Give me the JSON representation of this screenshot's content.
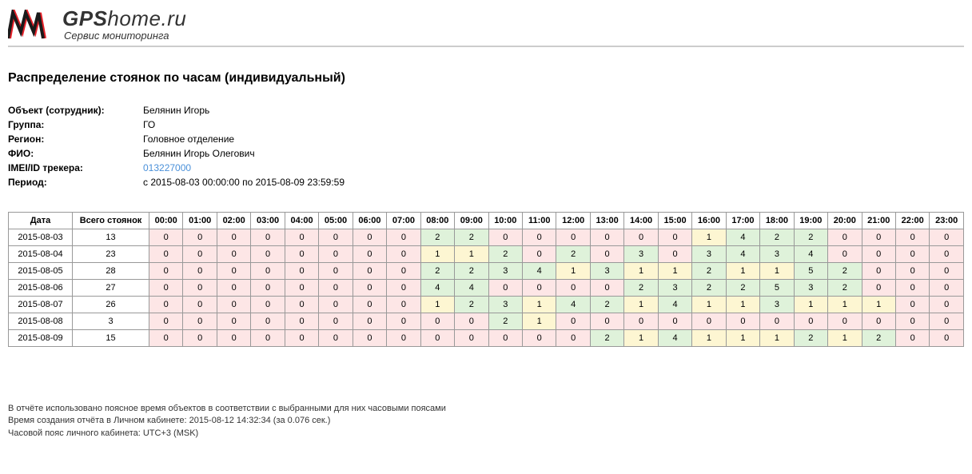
{
  "logo": {
    "gps": "GPS",
    "home": "home",
    "ru": ".ru",
    "tagline": "Сервис мониторинга"
  },
  "title": "Распределение стоянок по часам (индивидуальный)",
  "meta": {
    "object_label": "Объект (сотрудник):",
    "object_value": "Белянин Игорь",
    "group_label": "Группа:",
    "group_value": "ГО",
    "region_label": "Регион:",
    "region_value": "Головное отделение",
    "fio_label": "ФИО:",
    "fio_value": "Белянин Игорь Олегович",
    "imei_label": "IMEI/ID трекера:",
    "imei_value": "013227000",
    "period_label": "Период:",
    "period_value": "с 2015-08-03 00:00:00 по 2015-08-09 23:59:59"
  },
  "table": {
    "date_header": "Дата",
    "total_header": "Всего стоянок",
    "hours": [
      "00:00",
      "01:00",
      "02:00",
      "03:00",
      "04:00",
      "05:00",
      "06:00",
      "07:00",
      "08:00",
      "09:00",
      "10:00",
      "11:00",
      "12:00",
      "13:00",
      "14:00",
      "15:00",
      "16:00",
      "17:00",
      "18:00",
      "19:00",
      "20:00",
      "21:00",
      "22:00",
      "23:00"
    ],
    "rows": [
      {
        "date": "2015-08-03",
        "total": 13,
        "cells": [
          0,
          0,
          0,
          0,
          0,
          0,
          0,
          0,
          2,
          2,
          0,
          0,
          0,
          0,
          0,
          0,
          1,
          4,
          2,
          2,
          0,
          0,
          0,
          0
        ]
      },
      {
        "date": "2015-08-04",
        "total": 23,
        "cells": [
          0,
          0,
          0,
          0,
          0,
          0,
          0,
          0,
          1,
          1,
          2,
          0,
          2,
          0,
          3,
          0,
          3,
          4,
          3,
          4,
          0,
          0,
          0,
          0
        ]
      },
      {
        "date": "2015-08-05",
        "total": 28,
        "cells": [
          0,
          0,
          0,
          0,
          0,
          0,
          0,
          0,
          2,
          2,
          3,
          4,
          1,
          3,
          1,
          1,
          2,
          1,
          1,
          5,
          2,
          0,
          0,
          0
        ]
      },
      {
        "date": "2015-08-06",
        "total": 27,
        "cells": [
          0,
          0,
          0,
          0,
          0,
          0,
          0,
          0,
          4,
          4,
          0,
          0,
          0,
          0,
          2,
          3,
          2,
          2,
          5,
          3,
          2,
          0,
          0,
          0
        ]
      },
      {
        "date": "2015-08-07",
        "total": 26,
        "cells": [
          0,
          0,
          0,
          0,
          0,
          0,
          0,
          0,
          1,
          2,
          3,
          1,
          4,
          2,
          1,
          4,
          1,
          1,
          3,
          1,
          1,
          1,
          0,
          0
        ]
      },
      {
        "date": "2015-08-08",
        "total": 3,
        "cells": [
          0,
          0,
          0,
          0,
          0,
          0,
          0,
          0,
          0,
          0,
          2,
          1,
          0,
          0,
          0,
          0,
          0,
          0,
          0,
          0,
          0,
          0,
          0,
          0
        ]
      },
      {
        "date": "2015-08-09",
        "total": 15,
        "cells": [
          0,
          0,
          0,
          0,
          0,
          0,
          0,
          0,
          0,
          0,
          0,
          0,
          0,
          2,
          1,
          4,
          1,
          1,
          1,
          2,
          1,
          2,
          0,
          0
        ]
      }
    ]
  },
  "color_map": {
    "2015-08-03": [
      "p",
      "p",
      "p",
      "p",
      "p",
      "p",
      "p",
      "p",
      "g",
      "g",
      "p",
      "p",
      "p",
      "p",
      "p",
      "p",
      "y",
      "g",
      "g",
      "g",
      "p",
      "p",
      "p",
      "p"
    ],
    "2015-08-04": [
      "p",
      "p",
      "p",
      "p",
      "p",
      "p",
      "p",
      "p",
      "y",
      "y",
      "g",
      "p",
      "g",
      "p",
      "g",
      "p",
      "g",
      "g",
      "g",
      "g",
      "p",
      "p",
      "p",
      "p"
    ],
    "2015-08-05": [
      "p",
      "p",
      "p",
      "p",
      "p",
      "p",
      "p",
      "p",
      "g",
      "g",
      "g",
      "g",
      "y",
      "g",
      "y",
      "y",
      "g",
      "y",
      "y",
      "g",
      "g",
      "p",
      "p",
      "p"
    ],
    "2015-08-06": [
      "p",
      "p",
      "p",
      "p",
      "p",
      "p",
      "p",
      "p",
      "g",
      "g",
      "p",
      "p",
      "p",
      "p",
      "g",
      "g",
      "g",
      "g",
      "g",
      "g",
      "g",
      "p",
      "p",
      "p"
    ],
    "2015-08-07": [
      "p",
      "p",
      "p",
      "p",
      "p",
      "p",
      "p",
      "p",
      "y",
      "g",
      "g",
      "y",
      "g",
      "g",
      "y",
      "g",
      "y",
      "y",
      "g",
      "y",
      "y",
      "y",
      "p",
      "p"
    ],
    "2015-08-08": [
      "p",
      "p",
      "p",
      "p",
      "p",
      "p",
      "p",
      "p",
      "p",
      "p",
      "g",
      "y",
      "p",
      "p",
      "p",
      "p",
      "p",
      "p",
      "p",
      "p",
      "p",
      "p",
      "p",
      "p"
    ],
    "2015-08-09": [
      "p",
      "p",
      "p",
      "p",
      "p",
      "p",
      "p",
      "p",
      "p",
      "p",
      "p",
      "p",
      "p",
      "g",
      "y",
      "g",
      "y",
      "y",
      "y",
      "g",
      "y",
      "g",
      "p",
      "p"
    ]
  },
  "footer": {
    "line1": "В отчёте использовано поясное время объектов в соответствии с выбранными для них часовыми поясами",
    "line2": "Время создания отчёта в Личном кабинете: 2015-08-12 14:32:34 (за 0.076 сек.)",
    "line3": "Часовой пояс личного кабинета: UTC+3 (MSK)"
  }
}
